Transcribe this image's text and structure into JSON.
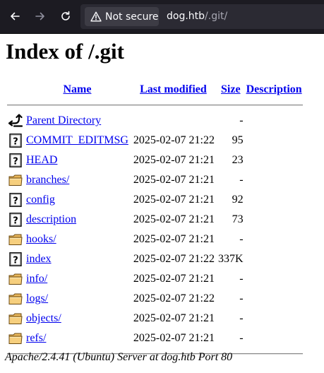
{
  "browser": {
    "security_label": "Not secure",
    "url_host": "dog.htb",
    "url_path": "/.git/"
  },
  "page": {
    "title": "Index of /.git",
    "columns": {
      "name": "Name",
      "last_modified": "Last modified",
      "size": "Size",
      "description": "Description"
    },
    "rows": [
      {
        "icon": "parent-directory-icon",
        "name": "Parent Directory",
        "modified": "",
        "size": "-"
      },
      {
        "icon": "unknown-file-icon",
        "name": "COMMIT_EDITMSG",
        "modified": "2025-02-07 21:22",
        "size": "95"
      },
      {
        "icon": "unknown-file-icon",
        "name": "HEAD",
        "modified": "2025-02-07 21:21",
        "size": "23"
      },
      {
        "icon": "folder-icon",
        "name": "branches/",
        "modified": "2025-02-07 21:21",
        "size": "-"
      },
      {
        "icon": "unknown-file-icon",
        "name": "config",
        "modified": "2025-02-07 21:21",
        "size": "92"
      },
      {
        "icon": "unknown-file-icon",
        "name": "description",
        "modified": "2025-02-07 21:21",
        "size": "73"
      },
      {
        "icon": "folder-icon",
        "name": "hooks/",
        "modified": "2025-02-07 21:21",
        "size": "-"
      },
      {
        "icon": "unknown-file-icon",
        "name": "index",
        "modified": "2025-02-07 21:22",
        "size": "337K"
      },
      {
        "icon": "folder-icon",
        "name": "info/",
        "modified": "2025-02-07 21:21",
        "size": "-"
      },
      {
        "icon": "folder-icon",
        "name": "logs/",
        "modified": "2025-02-07 21:22",
        "size": "-"
      },
      {
        "icon": "folder-icon",
        "name": "objects/",
        "modified": "2025-02-07 21:21",
        "size": "-"
      },
      {
        "icon": "folder-icon",
        "name": "refs/",
        "modified": "2025-02-07 21:21",
        "size": "-"
      }
    ],
    "footer": "Apache/2.4.41 (Ubuntu) Server at dog.htb Port 80"
  }
}
